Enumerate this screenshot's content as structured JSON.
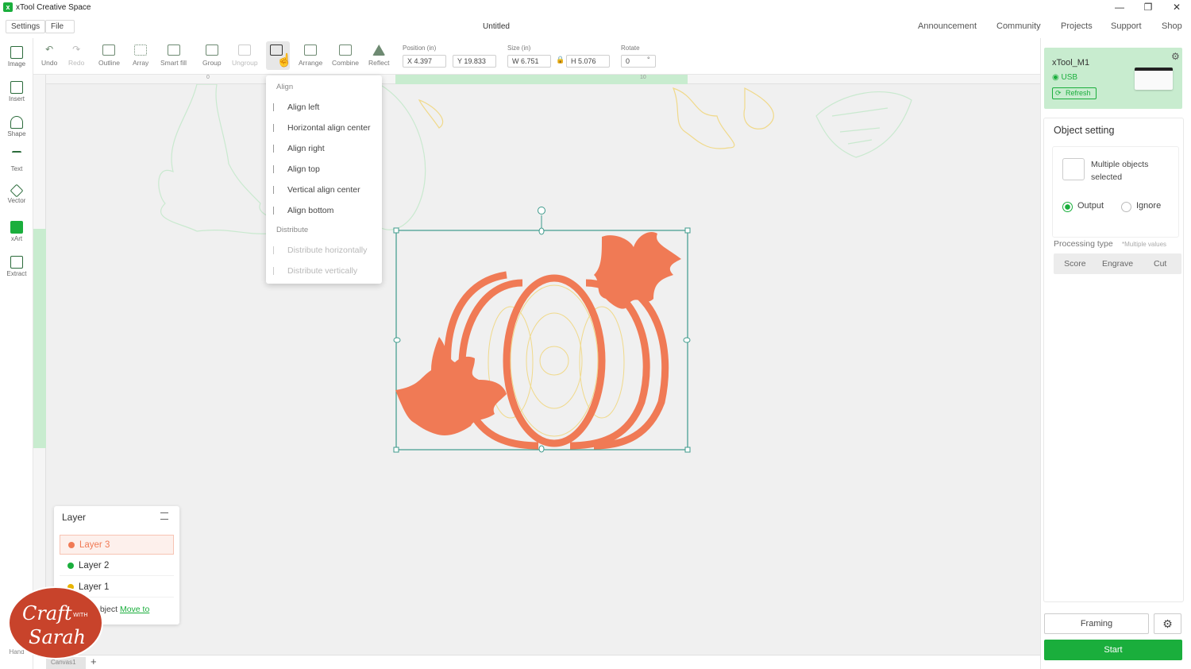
{
  "app": {
    "title": "xTool Creative Space",
    "doc_title": "Untitled"
  },
  "window_controls": {
    "minimize": "—",
    "maximize": "❐",
    "close": "✕"
  },
  "menu": {
    "settings": "Settings",
    "file": "File"
  },
  "topnav": [
    "Announcement",
    "Community",
    "Projects",
    "Support",
    "Shop"
  ],
  "left_tools": [
    {
      "label": "Image",
      "icon": "image-icon"
    },
    {
      "label": "Insert",
      "icon": "insert-icon"
    },
    {
      "label": "Shape",
      "icon": "shape-icon"
    },
    {
      "label": "Text",
      "icon": "text-icon"
    },
    {
      "label": "Vector",
      "icon": "pen-icon"
    },
    {
      "label": "xArt",
      "icon": "xart-icon"
    },
    {
      "label": "Extract",
      "icon": "extract-icon"
    }
  ],
  "left_tools_bottom": "Hand",
  "toolbar": {
    "undo": "Undo",
    "redo": "Redo",
    "outline": "Outline",
    "array": "Array",
    "smart_fill": "Smart fill",
    "group": "Group",
    "ungroup": "Ungroup",
    "arrange": "Arrange",
    "combine": "Combine",
    "reflect": "Reflect",
    "position_label": "Position (in)",
    "x": "X 4.397",
    "y": "Y 19.833",
    "size_label": "Size (in)",
    "w": "W 6.751",
    "h": "H 5.076",
    "rotate_label": "Rotate",
    "rotate": "0",
    "rotate_unit": "°"
  },
  "ruler": {
    "mark_0": "0",
    "mark_10": "10"
  },
  "align_menu": {
    "align_header": "Align",
    "items": [
      "Align left",
      "Horizontal align center",
      "Align right",
      "Align top",
      "Vertical align center",
      "Align bottom"
    ],
    "distribute_header": "Distribute",
    "distribute_items": [
      "Distribute horizontally",
      "Distribute vertically"
    ]
  },
  "layers": {
    "title": "Layer",
    "rows": [
      {
        "name": "Layer 3",
        "color": "#f07a55"
      },
      {
        "name": "Layer 2",
        "color": "#1aae3c"
      },
      {
        "name": "Layer 1",
        "color": "#e8b400"
      }
    ],
    "move_prefix": "object",
    "move_link": "Move to"
  },
  "canvas_tabs": {
    "tab": "Canvas1",
    "add": "+"
  },
  "logo": {
    "line1": "Craft",
    "with": "WITH",
    "line2": "Sarah"
  },
  "device": {
    "name": "xTool_M1",
    "connection": "USB",
    "refresh": "Refresh"
  },
  "object_setting": {
    "title": "Object setting",
    "desc": "Multiple objects selected",
    "output": "Output",
    "ignore": "Ignore",
    "processing_label": "Processing type",
    "processing_note": "*Multiple values",
    "types": [
      "Score",
      "Engrave",
      "Cut"
    ]
  },
  "actions": {
    "framing": "Framing",
    "start": "Start"
  },
  "colors": {
    "accent": "#1aae3c",
    "orange": "#f07a55",
    "line_yellow": "#f0d98a"
  }
}
